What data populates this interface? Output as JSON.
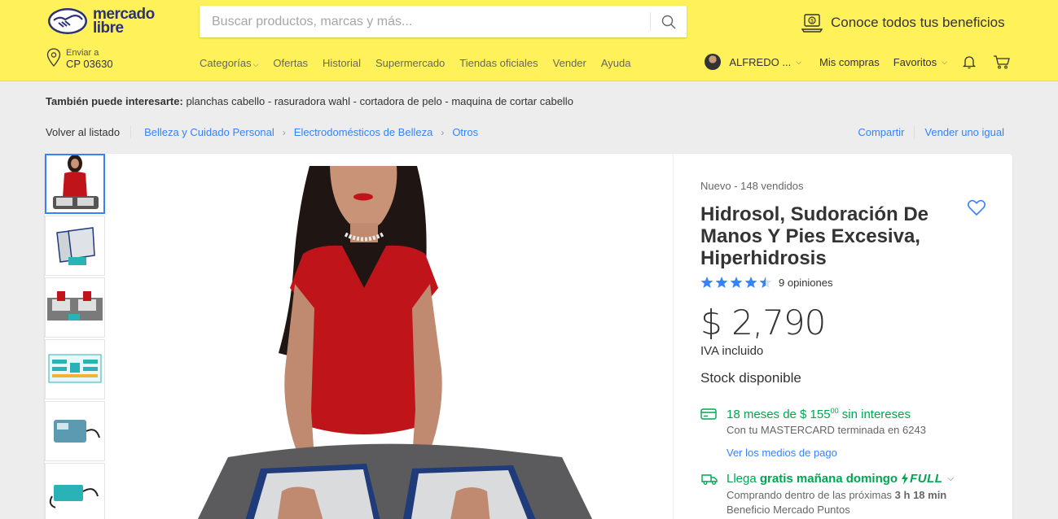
{
  "header": {
    "logo_line1": "mercado",
    "logo_line2": "libre",
    "search_placeholder": "Buscar productos, marcas y más...",
    "benefits_label": "Conoce todos tus beneficios",
    "location": {
      "label": "Enviar a",
      "value": "CP 03630"
    },
    "nav": [
      "Categorías",
      "Ofertas",
      "Historial",
      "Supermercado",
      "Tiendas oficiales",
      "Vender",
      "Ayuda"
    ],
    "user_name": "ALFREDO ...",
    "my_purchases": "Mis compras",
    "favorites": "Favoritos"
  },
  "related": {
    "label": "También puede interesarte:",
    "items": "planchas cabello - rasuradora wahl - cortadora de pelo - maquina de cortar cabello"
  },
  "breadcrumb": {
    "back": "Volver al listado",
    "items": [
      "Belleza y Cuidado Personal",
      "Electrodomésticos de Belleza",
      "Otros"
    ]
  },
  "actions": {
    "share": "Compartir",
    "sell_same": "Vender uno igual"
  },
  "product": {
    "condition": "Nuevo  -  148 vendidos",
    "title": "Hidrosol, Sudoración De Manos Y Pies Excesiva, Hiperhidrosis",
    "rating": 4.5,
    "reviews": "9 opiniones",
    "price": "$ 2,790",
    "tax": "IVA incluido",
    "stock": "Stock disponible",
    "installments_prefix": "18 meses de $ 155",
    "installments_cents": "00",
    "installments_suffix": " sin intereses",
    "card_note": "Con tu MASTERCARD terminada en 6243",
    "payment_link": "Ver los medios de pago",
    "shipping_prefix": "Llega ",
    "shipping_bold": "gratis mañana domingo",
    "full_label": "FULL",
    "shipping_note_prefix": "Comprando dentro de las próximas ",
    "shipping_note_time": "3 h 18 min",
    "points_note": "Beneficio Mercado Puntos"
  },
  "colors": {
    "brand_yellow": "#fff159",
    "link_blue": "#3483fa",
    "green": "#00a650",
    "star_blue": "#3483fa"
  }
}
